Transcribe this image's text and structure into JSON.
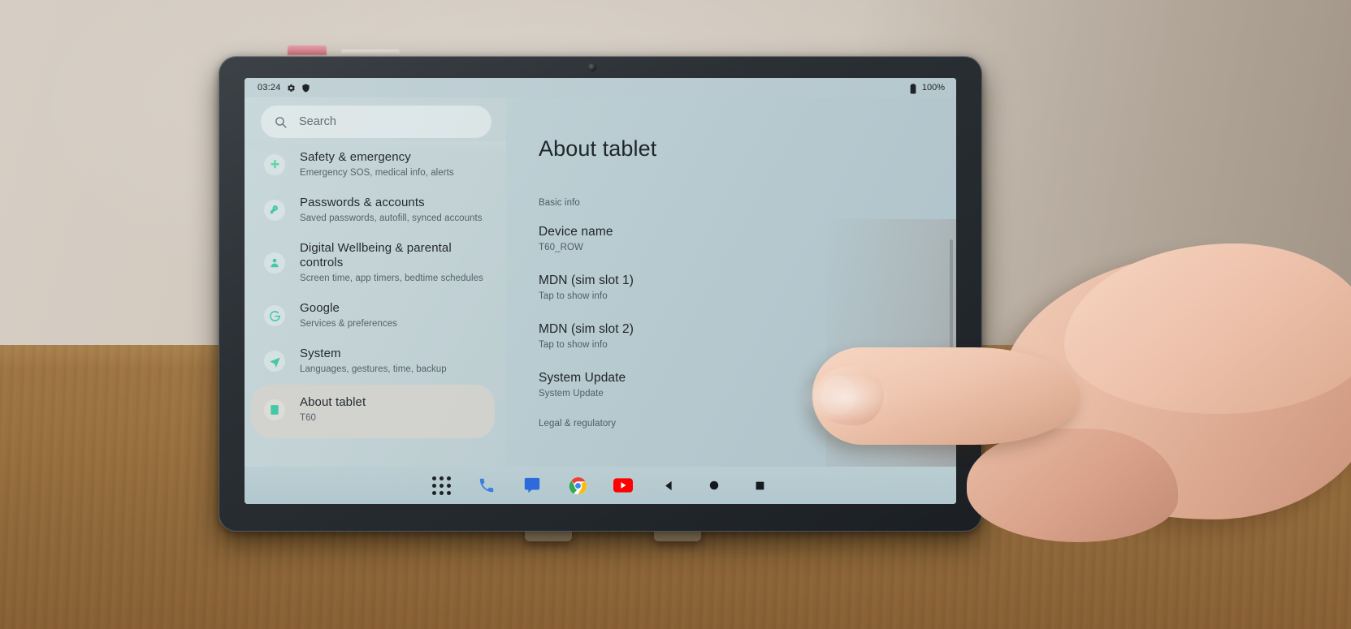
{
  "status_bar": {
    "clock": "03:24",
    "icons": [
      "gear-icon",
      "shield-icon"
    ],
    "battery_percent": "100%",
    "battery_icon": "battery-full-icon"
  },
  "search": {
    "placeholder": "Search",
    "value": "",
    "icon": "search-icon"
  },
  "sidebar": {
    "items": [
      {
        "title": "Safety & emergency",
        "subtitle": "Emergency SOS, medical info, alerts",
        "icon": "safety-emergency-icon",
        "selected": false
      },
      {
        "title": "Passwords & accounts",
        "subtitle": "Saved passwords, autofill, synced accounts",
        "icon": "key-icon",
        "selected": false
      },
      {
        "title": "Digital Wellbeing & parental controls",
        "subtitle": "Screen time, app timers, bedtime schedules",
        "icon": "person-icon",
        "selected": false
      },
      {
        "title": "Google",
        "subtitle": "Services & preferences",
        "icon": "google-g-icon",
        "selected": false
      },
      {
        "title": "System",
        "subtitle": "Languages, gestures, time, backup",
        "icon": "system-info-icon",
        "selected": false
      },
      {
        "title": "About tablet",
        "subtitle": "T60",
        "icon": "tablet-info-icon",
        "selected": true
      }
    ]
  },
  "content": {
    "page_title": "About tablet",
    "sections": [
      {
        "label": "Basic info",
        "rows": [
          {
            "title": "Device name",
            "value": "T60_ROW"
          },
          {
            "title": "MDN (sim slot 1)",
            "value": "Tap to show info"
          },
          {
            "title": "MDN (sim slot 2)",
            "value": "Tap to show info"
          },
          {
            "title": "System Update",
            "value": "System Update"
          }
        ]
      },
      {
        "label": "Legal & regulatory",
        "rows": []
      }
    ]
  },
  "taskbar": {
    "items": [
      {
        "name": "app-drawer-icon",
        "label": "App drawer"
      },
      {
        "name": "phone-icon",
        "label": "Phone"
      },
      {
        "name": "messages-icon",
        "label": "Messages"
      },
      {
        "name": "chrome-icon",
        "label": "Chrome"
      },
      {
        "name": "youtube-icon",
        "label": "YouTube"
      },
      {
        "name": "back-nav-icon",
        "label": "Back"
      },
      {
        "name": "home-nav-icon",
        "label": "Home"
      },
      {
        "name": "recents-nav-icon",
        "label": "Recents"
      }
    ]
  },
  "colors": {
    "screen_bg": "#bbccd2",
    "sidebar_bg": "#c6d6da",
    "selected_item_bg": "#d6d2cd",
    "accent_teal": "#2fc8a0",
    "text_primary": "#202629",
    "text_secondary": "#515e65"
  }
}
